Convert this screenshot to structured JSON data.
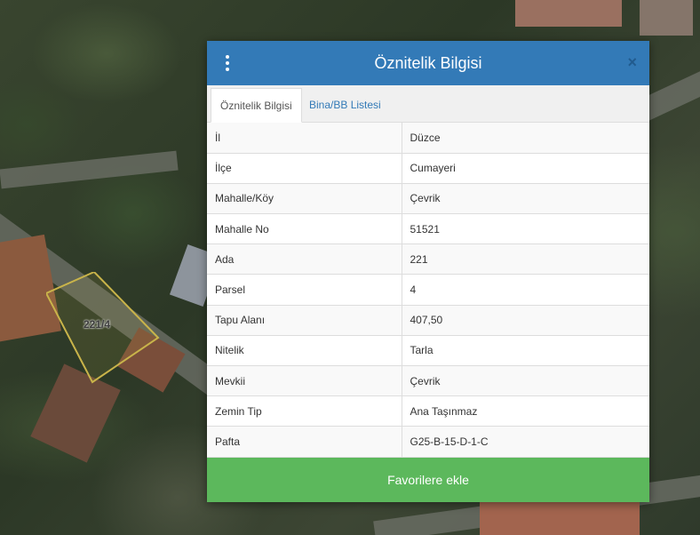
{
  "map": {
    "parcel_label": "221/4",
    "parcel_outline_color": "#c9b44a"
  },
  "popup": {
    "title": "Öznitelik Bilgisi",
    "header_color": "#337ab7",
    "menu_icon": "vertical-dots-icon",
    "close_icon": "close-icon",
    "close_glyph": "×",
    "tabs": [
      {
        "label": "Öznitelik Bilgisi",
        "active": true
      },
      {
        "label": "Bina/BB Listesi",
        "active": false
      }
    ],
    "rows": [
      {
        "key": "İl",
        "value": "Düzce"
      },
      {
        "key": "İlçe",
        "value": "Cumayeri"
      },
      {
        "key": "Mahalle/Köy",
        "value": "Çevrik"
      },
      {
        "key": "Mahalle No",
        "value": "51521"
      },
      {
        "key": "Ada",
        "value": "221"
      },
      {
        "key": "Parsel",
        "value": "4"
      },
      {
        "key": "Tapu Alanı",
        "value": "407,50"
      },
      {
        "key": "Nitelik",
        "value": "Tarla"
      },
      {
        "key": "Mevkii",
        "value": "Çevrik"
      },
      {
        "key": "Zemin Tip",
        "value": "Ana Taşınmaz"
      },
      {
        "key": "Pafta",
        "value": "G25-B-15-D-1-C"
      }
    ],
    "favorite_button_label": "Favorilere ekle",
    "favorite_button_color": "#5cb85c"
  }
}
